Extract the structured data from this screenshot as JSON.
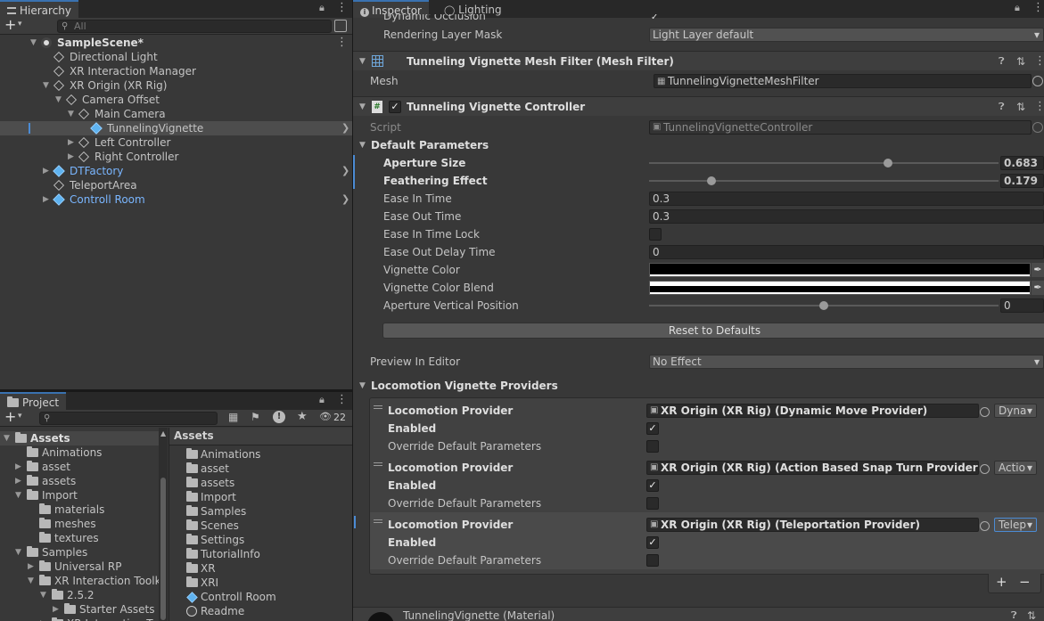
{
  "hierarchy": {
    "tab": "Hierarchy",
    "search_placeholder": "All",
    "items": [
      {
        "label": "SampleScene*"
      },
      {
        "label": "Directional Light"
      },
      {
        "label": "XR Interaction Manager"
      },
      {
        "label": "XR Origin (XR Rig)"
      },
      {
        "label": "Camera Offset"
      },
      {
        "label": "Main Camera"
      },
      {
        "label": "TunnelingVignette"
      },
      {
        "label": "Left Controller"
      },
      {
        "label": "Right Controller"
      },
      {
        "label": "DTFactory"
      },
      {
        "label": "TeleportArea"
      },
      {
        "label": "Controll Room"
      }
    ]
  },
  "project": {
    "tab": "Project",
    "hidden_count": "22",
    "tree": [
      {
        "label": "Assets"
      },
      {
        "label": "Animations"
      },
      {
        "label": "asset"
      },
      {
        "label": "assets"
      },
      {
        "label": "Import"
      },
      {
        "label": "materials"
      },
      {
        "label": "meshes"
      },
      {
        "label": "textures"
      },
      {
        "label": "Samples"
      },
      {
        "label": "Universal RP"
      },
      {
        "label": "XR Interaction Toolk"
      },
      {
        "label": "2.5.2"
      },
      {
        "label": "Starter Assets"
      },
      {
        "label": "XR Interaction Toolk"
      }
    ],
    "breadcrumb": "Assets",
    "contents": [
      {
        "label": "Animations"
      },
      {
        "label": "asset"
      },
      {
        "label": "assets"
      },
      {
        "label": "Import"
      },
      {
        "label": "Samples"
      },
      {
        "label": "Scenes"
      },
      {
        "label": "Settings"
      },
      {
        "label": "TutorialInfo"
      },
      {
        "label": "XR"
      },
      {
        "label": "XRI"
      },
      {
        "label": "Controll Room"
      },
      {
        "label": "Readme"
      }
    ]
  },
  "inspector": {
    "tabs": {
      "inspector": "Inspector",
      "lighting": "Lighting"
    },
    "dynamic_occlusion": "Dynamic Occlusion",
    "rendering_layer_mask": {
      "label": "Rendering Layer Mask",
      "value": "Light Layer default"
    },
    "mesh_filter": {
      "title": "Tunneling Vignette Mesh Filter (Mesh Filter)",
      "mesh_label": "Mesh",
      "mesh_value": "TunnelingVignetteMeshFilter"
    },
    "controller": {
      "title": "Tunneling Vignette Controller",
      "script_label": "Script",
      "script_value": "TunnelingVignetteController",
      "default_params": "Default Parameters",
      "aperture_size": {
        "label": "Aperture Size",
        "value": "0.683",
        "fraction": 0.683
      },
      "feathering": {
        "label": "Feathering Effect",
        "value": "0.179",
        "fraction": 0.179
      },
      "ease_in": {
        "label": "Ease In Time",
        "value": "0.3"
      },
      "ease_out": {
        "label": "Ease Out Time",
        "value": "0.3"
      },
      "ease_in_lock": {
        "label": "Ease In Time Lock"
      },
      "ease_out_delay": {
        "label": "Ease Out Delay Time",
        "value": "0"
      },
      "vignette_color": {
        "label": "Vignette Color"
      },
      "vignette_blend": {
        "label": "Vignette Color Blend"
      },
      "aperture_vertical": {
        "label": "Aperture Vertical Position",
        "value": "0",
        "fraction": 0.5
      },
      "reset_button": "Reset to Defaults",
      "preview": {
        "label": "Preview In Editor",
        "value": "No Effect"
      },
      "providers_header": "Locomotion Vignette Providers",
      "providers": [
        {
          "label": "Locomotion Provider",
          "value": "XR Origin (XR Rig) (Dynamic Move Provider)",
          "mode": "Dyna",
          "enabled_label": "Enabled",
          "override_label": "Override Default Parameters"
        },
        {
          "label": "Locomotion Provider",
          "value": "XR Origin (XR Rig) (Action Based Snap Turn Provider)",
          "mode": "Actio",
          "enabled_label": "Enabled",
          "override_label": "Override Default Parameters"
        },
        {
          "label": "Locomotion Provider",
          "value": "XR Origin (XR Rig) (Teleportation Provider)",
          "mode": "Telep",
          "enabled_label": "Enabled",
          "override_label": "Override Default Parameters"
        }
      ]
    },
    "material": "TunnelingVignette (Material)"
  }
}
